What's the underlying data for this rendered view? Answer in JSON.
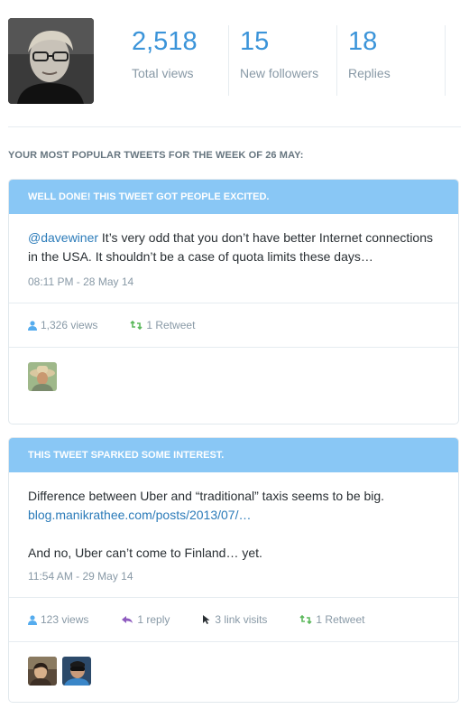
{
  "stats": [
    {
      "value": "2,518",
      "label": "Total views"
    },
    {
      "value": "15",
      "label": "New followers"
    },
    {
      "value": "18",
      "label": "Replies"
    }
  ],
  "section_title": "YOUR MOST POPULAR TWEETS FOR THE WEEK OF 26 MAY:",
  "tweets": [
    {
      "header": "WELL DONE! THIS TWEET GOT PEOPLE EXCITED.",
      "mention": "@davewiner",
      "text": " It’s very odd that you don’t have better Internet connections in the USA. It shouldn’t be a case of quota limits these days…",
      "time": "08:11 PM - 28 May 14",
      "views": "1,326 views",
      "retweets": "1 Retweet"
    },
    {
      "header": "THIS TWEET SPARKED SOME INTEREST.",
      "text_line1": "Difference between Uber and “traditional” taxis seems to be big.",
      "link": "blog.manikrathee.com/posts/2013/07/…",
      "text_line2": "And no, Uber can’t come to Finland… yet.",
      "time": "11:54 AM - 29 May 14",
      "views": "123 views",
      "replies": "1 reply",
      "link_visits": "3 link visits",
      "retweets": "1 Retweet"
    }
  ],
  "colors": {
    "accent": "#3b94d9",
    "header_bg": "#89c7f5",
    "retweet": "#5cb85c",
    "reply": "#8e5bbf"
  }
}
